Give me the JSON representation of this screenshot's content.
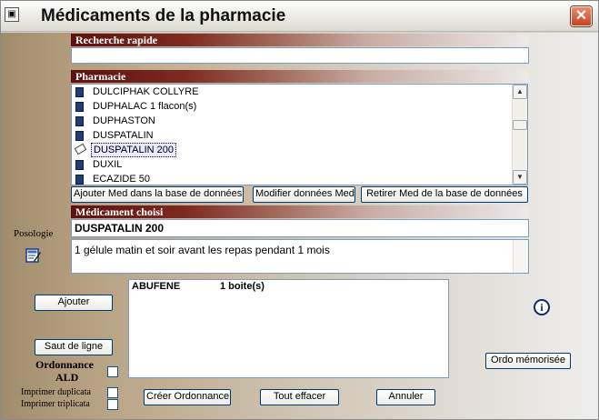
{
  "window": {
    "title": "Médicaments de la pharmacie",
    "system_icon": "window-menu-icon",
    "close_icon": "close-icon"
  },
  "search": {
    "header": "Recherche rapide",
    "value": ""
  },
  "pharmacy": {
    "header": "Pharmacie",
    "items": [
      {
        "label": "DULCIPHAK COLLYRE",
        "icon": "medicine-box-icon"
      },
      {
        "label": "DUPHALAC 1 flacon(s)",
        "icon": "medicine-box-icon"
      },
      {
        "label": "DUPHASTON",
        "icon": "medicine-box-icon"
      },
      {
        "label": "DUSPATALIN",
        "icon": "medicine-box-icon"
      },
      {
        "label": "DUSPATALIN 200",
        "icon": "pill-icon",
        "selected": true
      },
      {
        "label": "DUXIL",
        "icon": "medicine-box-icon"
      },
      {
        "label": "ECAZIDE 50",
        "icon": "medicine-box-icon"
      }
    ],
    "buttons": {
      "add": "Ajouter Med dans la base de données",
      "modify": "Modifier données Med",
      "remove": "Retirer Med de la base de données"
    }
  },
  "chosen": {
    "header": "Médicament choisi",
    "name": "DUSPATALIN 200",
    "dosage": "1 gélule matin et soir avant les repas pendant 1 mois"
  },
  "left": {
    "posologie": "Posologie",
    "posologie_icon": "edit-dosage-icon",
    "add_button": "Ajouter",
    "line_break_button": "Saut de ligne",
    "ald_label_1": "Ordonnance",
    "ald_label_2": "ALD",
    "duplicate_label": "Imprimer duplicata",
    "triplicate_label": "Imprimer triplicata"
  },
  "prescription": {
    "drug": "ABUFENE",
    "quantity": "1 boite(s)"
  },
  "actions": {
    "create": "Créer Ordonnance",
    "clear": "Tout effacer",
    "cancel": "Annuler",
    "memorized": "Ordo mémorisée",
    "info_icon": "info-icon"
  },
  "colors": {
    "section_header": "#5e1111",
    "title_close": "#c8421c",
    "input_border": "#7f9db9",
    "button_border": "#003c74"
  }
}
